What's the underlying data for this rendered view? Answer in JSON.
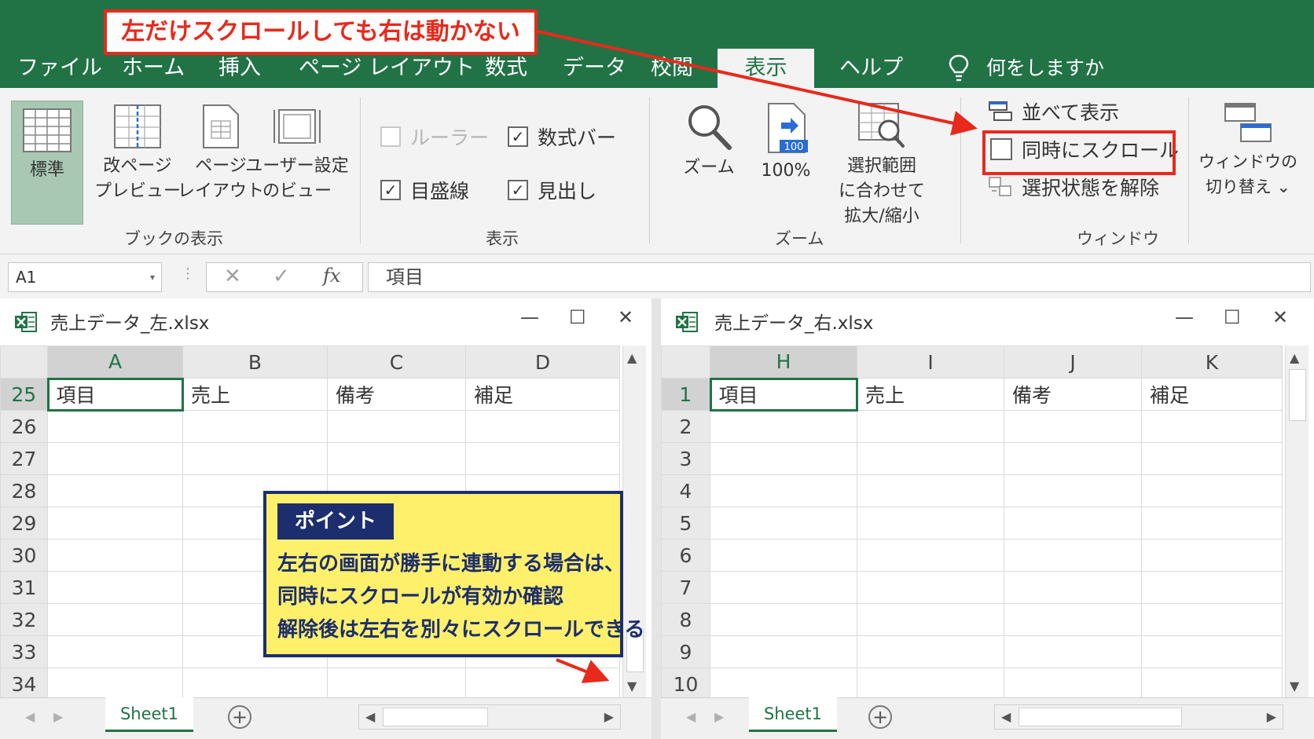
{
  "ribbon_tabs": [
    "ファイル",
    "ホーム",
    "挿入",
    "ページ レイアウト",
    "数式",
    "データ",
    "校閲",
    "表示",
    "ヘルプ"
  ],
  "active_tab": "表示",
  "tell_me": "何をしますか",
  "workbook_views": {
    "normal": "標準",
    "page_break_l1": "改ページ",
    "page_break_l2": "プレビュー",
    "page_layout_l1": "ページ",
    "page_layout_l2": "レイアウト",
    "custom_l1": "ユーザー設定",
    "custom_l2": "のビュー",
    "group": "ブックの表示"
  },
  "show": {
    "ruler": "ルーラー",
    "formula_bar": "数式バー",
    "gridlines": "目盛線",
    "headings": "見出し",
    "group": "表示"
  },
  "zoom": {
    "zoom": "ズーム",
    "hundred": "100%",
    "badge": "100",
    "sel_l1": "選択範囲",
    "sel_l2": "に合わせて",
    "sel_l3": "拡大/縮小",
    "group": "ズーム"
  },
  "window": {
    "side_by_side": "並べて表示",
    "sync_scroll": "同時にスクロール",
    "reset": "選択状態を解除",
    "group": "ウィンドウ",
    "switch_l1": "ウィンドウの",
    "switch_l2": "切り替え",
    "switch_caret": "⌄"
  },
  "formula_bar": {
    "name_box": "A1",
    "dropdown": "▾",
    "dots": "⋮",
    "cancel": "✕",
    "enter": "✓",
    "fx": "fx",
    "value": "項目"
  },
  "window_controls": {
    "min": "—",
    "max": "☐",
    "close": "✕"
  },
  "left_book": {
    "title": "売上データ_左.xlsx",
    "columns": [
      "A",
      "B",
      "C",
      "D"
    ],
    "rows": [
      "25",
      "26",
      "27",
      "28",
      "29",
      "30",
      "31",
      "32",
      "33",
      "34"
    ],
    "cells": [
      "項目",
      "売上",
      "備考",
      "補足"
    ],
    "sheet": "Sheet1"
  },
  "right_book": {
    "title": "売上データ_右.xlsx",
    "columns": [
      "H",
      "I",
      "J",
      "K"
    ],
    "rows": [
      "1",
      "2",
      "3",
      "4",
      "5",
      "6",
      "7",
      "8",
      "9",
      "10"
    ],
    "cells": [
      "項目",
      "売上",
      "備考",
      "補足"
    ],
    "sheet": "Sheet1"
  },
  "scroll": {
    "up": "▲",
    "down": "▼",
    "left": "◀",
    "right": "▶",
    "nav_left": "◀",
    "nav_right": "▶",
    "add": "+"
  },
  "annotations": {
    "top_callout": "左だけスクロールしても右は動かない",
    "point_tag": "ポイント",
    "point_lines": [
      "左右の画面が勝手に連動する場合は、",
      "同時にスクロールが有効か確認",
      "解除後は左右を別々にスクロールできる"
    ]
  },
  "colors": {
    "excel_green": "#217346",
    "callout_red": "#e8291c",
    "point_yellow": "#fff06b",
    "point_navy": "#1d2e6e"
  }
}
